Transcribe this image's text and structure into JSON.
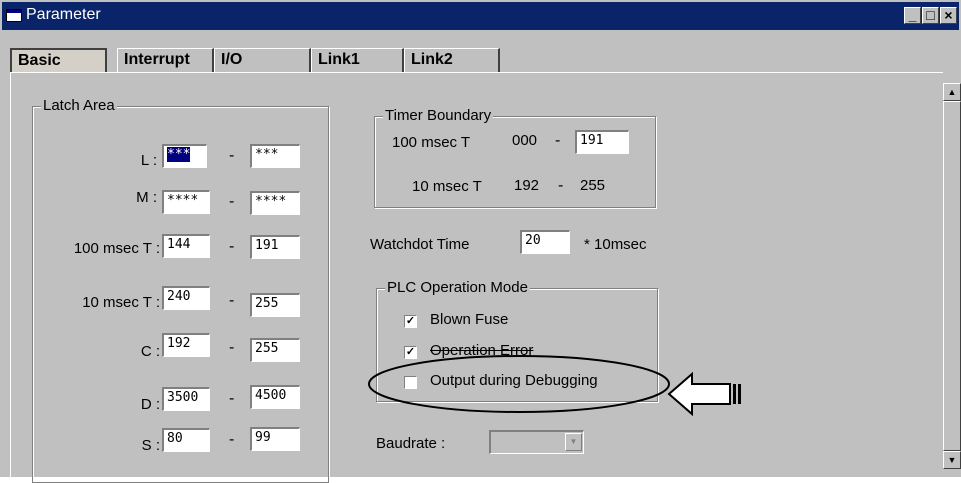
{
  "window": {
    "title": "Parameter",
    "buttons": {
      "minimize": "_",
      "maximize": "□",
      "close": "×"
    }
  },
  "tabs": [
    {
      "label": "Basic"
    },
    {
      "label": "Interrupt"
    },
    {
      "label": "I/O"
    },
    {
      "label": "Link1"
    },
    {
      "label": "Link2"
    }
  ],
  "latch_area": {
    "title": "Latch Area",
    "rows": [
      {
        "label": "L :",
        "from": "***",
        "to": "***"
      },
      {
        "label": "M :",
        "from": "****",
        "to": "****"
      },
      {
        "label": "100 msec T :",
        "from": "144",
        "to": "191"
      },
      {
        "label": "10 msec T :",
        "from": "240",
        "to": "255"
      },
      {
        "label": "C :",
        "from": "192",
        "to": "255"
      },
      {
        "label": "D :",
        "from": "3500",
        "to": "4500"
      },
      {
        "label": "S :",
        "from": "80",
        "to": "99"
      }
    ],
    "dash": "-"
  },
  "timer_boundary": {
    "title": "Timer Boundary",
    "row1_label": "100 msec T",
    "row1_from": "000",
    "row1_to": "191",
    "row2_label": "10 msec T",
    "row2_from": "192",
    "row2_to": "255",
    "dash": "-"
  },
  "watchdog": {
    "label": "Watchdot Time",
    "value": "20",
    "unit": "* 10msec"
  },
  "plc_mode": {
    "title": "PLC Operation Mode",
    "options": [
      {
        "label": "Blown Fuse",
        "checked": true
      },
      {
        "label": "Operation Error",
        "checked": true
      },
      {
        "label": "Output during Debugging",
        "checked": false
      }
    ]
  },
  "baudrate": {
    "label": "Baudrate :",
    "value": ""
  },
  "colors": {
    "titlebar": "#0a246a",
    "face": "#c0c0c0",
    "annotation": "#000000"
  }
}
